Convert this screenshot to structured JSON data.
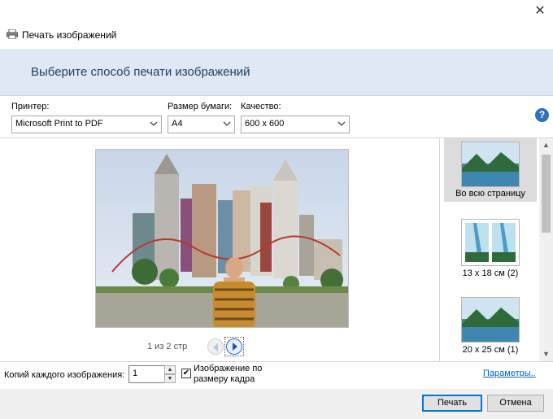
{
  "window": {
    "title": "Печать изображений",
    "close_symbol": "✕",
    "icon": "printer-icon"
  },
  "header": {
    "title": "Выберите способ печати изображений"
  },
  "options": {
    "printer_label": "Принтер:",
    "printer_value": "Microsoft Print to PDF",
    "paper_label": "Размер бумаги:",
    "paper_value": "A4",
    "quality_label": "Качество:",
    "quality_value": "600 x 600",
    "help_symbol": "?"
  },
  "preview": {
    "page_info": "1 из 2 стр"
  },
  "layouts": [
    {
      "label": "Во всю страницу",
      "selected": true
    },
    {
      "label": "13 x 18 см (2)",
      "selected": false
    },
    {
      "label": "20 x 25 см (1)",
      "selected": false
    }
  ],
  "bottom": {
    "copies_label": "Копий каждого изображения:",
    "copies_value": "1",
    "fit_label": "Изображение по размеру кадра",
    "fit_checked": true,
    "check_mark": "✔",
    "params_link": "Параметры..",
    "print_button": "Печать",
    "cancel_button": "Отмена"
  },
  "colors": {
    "header_bg": "#dfe9f5",
    "header_text": "#1e3f66",
    "link": "#0066cc",
    "accent": "#0078d7"
  }
}
